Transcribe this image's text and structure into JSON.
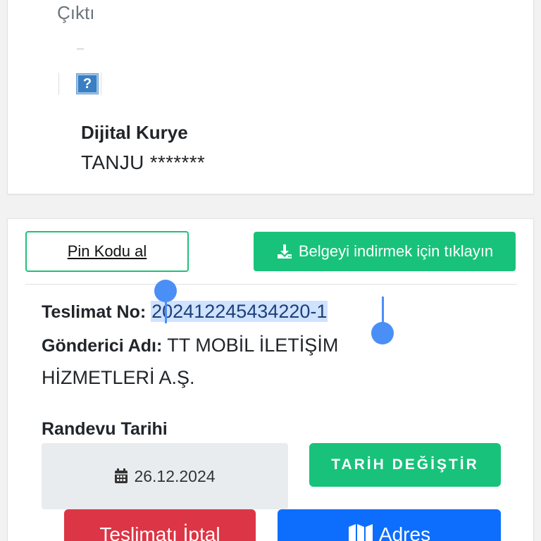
{
  "top_card": {
    "output_label": "Çıktı",
    "image_placeholder": "?",
    "courier_label": "Dijital Kurye",
    "courier_name": "TANJU *******"
  },
  "actions": {
    "pin_button": "Pin Kodu al",
    "download_button": "Belgeyi indirmek için tıklayın"
  },
  "delivery": {
    "teslimat_label": "Teslimat No",
    "teslimat_value": "202412245434220-1",
    "gonderici_label": "Gönderici Adı",
    "gonderici_value_line1": "TT MOBİL İLETİŞİM",
    "gonderici_value_line2": "HİZMETLERİ A.Ş."
  },
  "appointment": {
    "label": "Randevu Tarihi",
    "date": "26.12.2024",
    "change_button": "TARİH DEĞİŞTİR"
  },
  "bottom_buttons": {
    "cancel": "Teslimatı İptal",
    "address": "Adres"
  },
  "icons": {
    "download": "download-icon",
    "calendar": "calendar-icon",
    "map": "map-icon",
    "image": "broken-image-icon"
  },
  "colors": {
    "green": "#18c27a",
    "red": "#dc3545",
    "blue": "#0d6efd",
    "selection": "#cfe2ff",
    "handle": "#4a8ff5"
  }
}
